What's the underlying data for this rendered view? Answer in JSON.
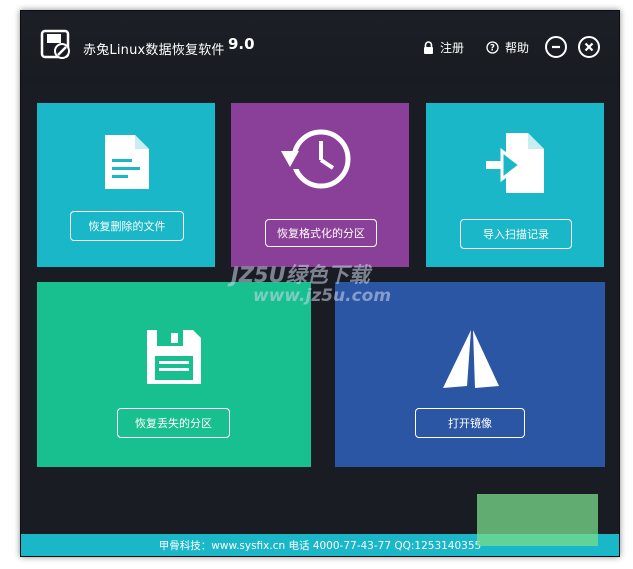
{
  "title": {
    "app_name": "赤兔Linux数据恢复软件",
    "version": "9.0"
  },
  "header_links": {
    "register": "注册",
    "help": "帮助"
  },
  "tiles": {
    "recover_deleted": {
      "label": "恢复删除的文件",
      "color": "#1ab7c8",
      "icon": "document-icon"
    },
    "recover_formatted": {
      "label": "恢复格式化的分区",
      "color": "#8a4098",
      "icon": "history-clock-icon"
    },
    "import_scan": {
      "label": "导入扫描记录",
      "color": "#1ab7c8",
      "icon": "import-file-icon"
    },
    "recover_lost": {
      "label": "恢复丢失的分区",
      "color": "#17c08e",
      "icon": "floppy-disk-icon"
    },
    "open_image": {
      "label": "打开镜像",
      "color": "#2a56a4",
      "icon": "sail-icon"
    }
  },
  "watermark": {
    "line1": "JZ5U绿色下载",
    "line2": "www.jz5u.com"
  },
  "footer": {
    "text": "甲骨科技：www.sysfix.cn 电话 4000-77-43-77 QQ:1253140355"
  }
}
